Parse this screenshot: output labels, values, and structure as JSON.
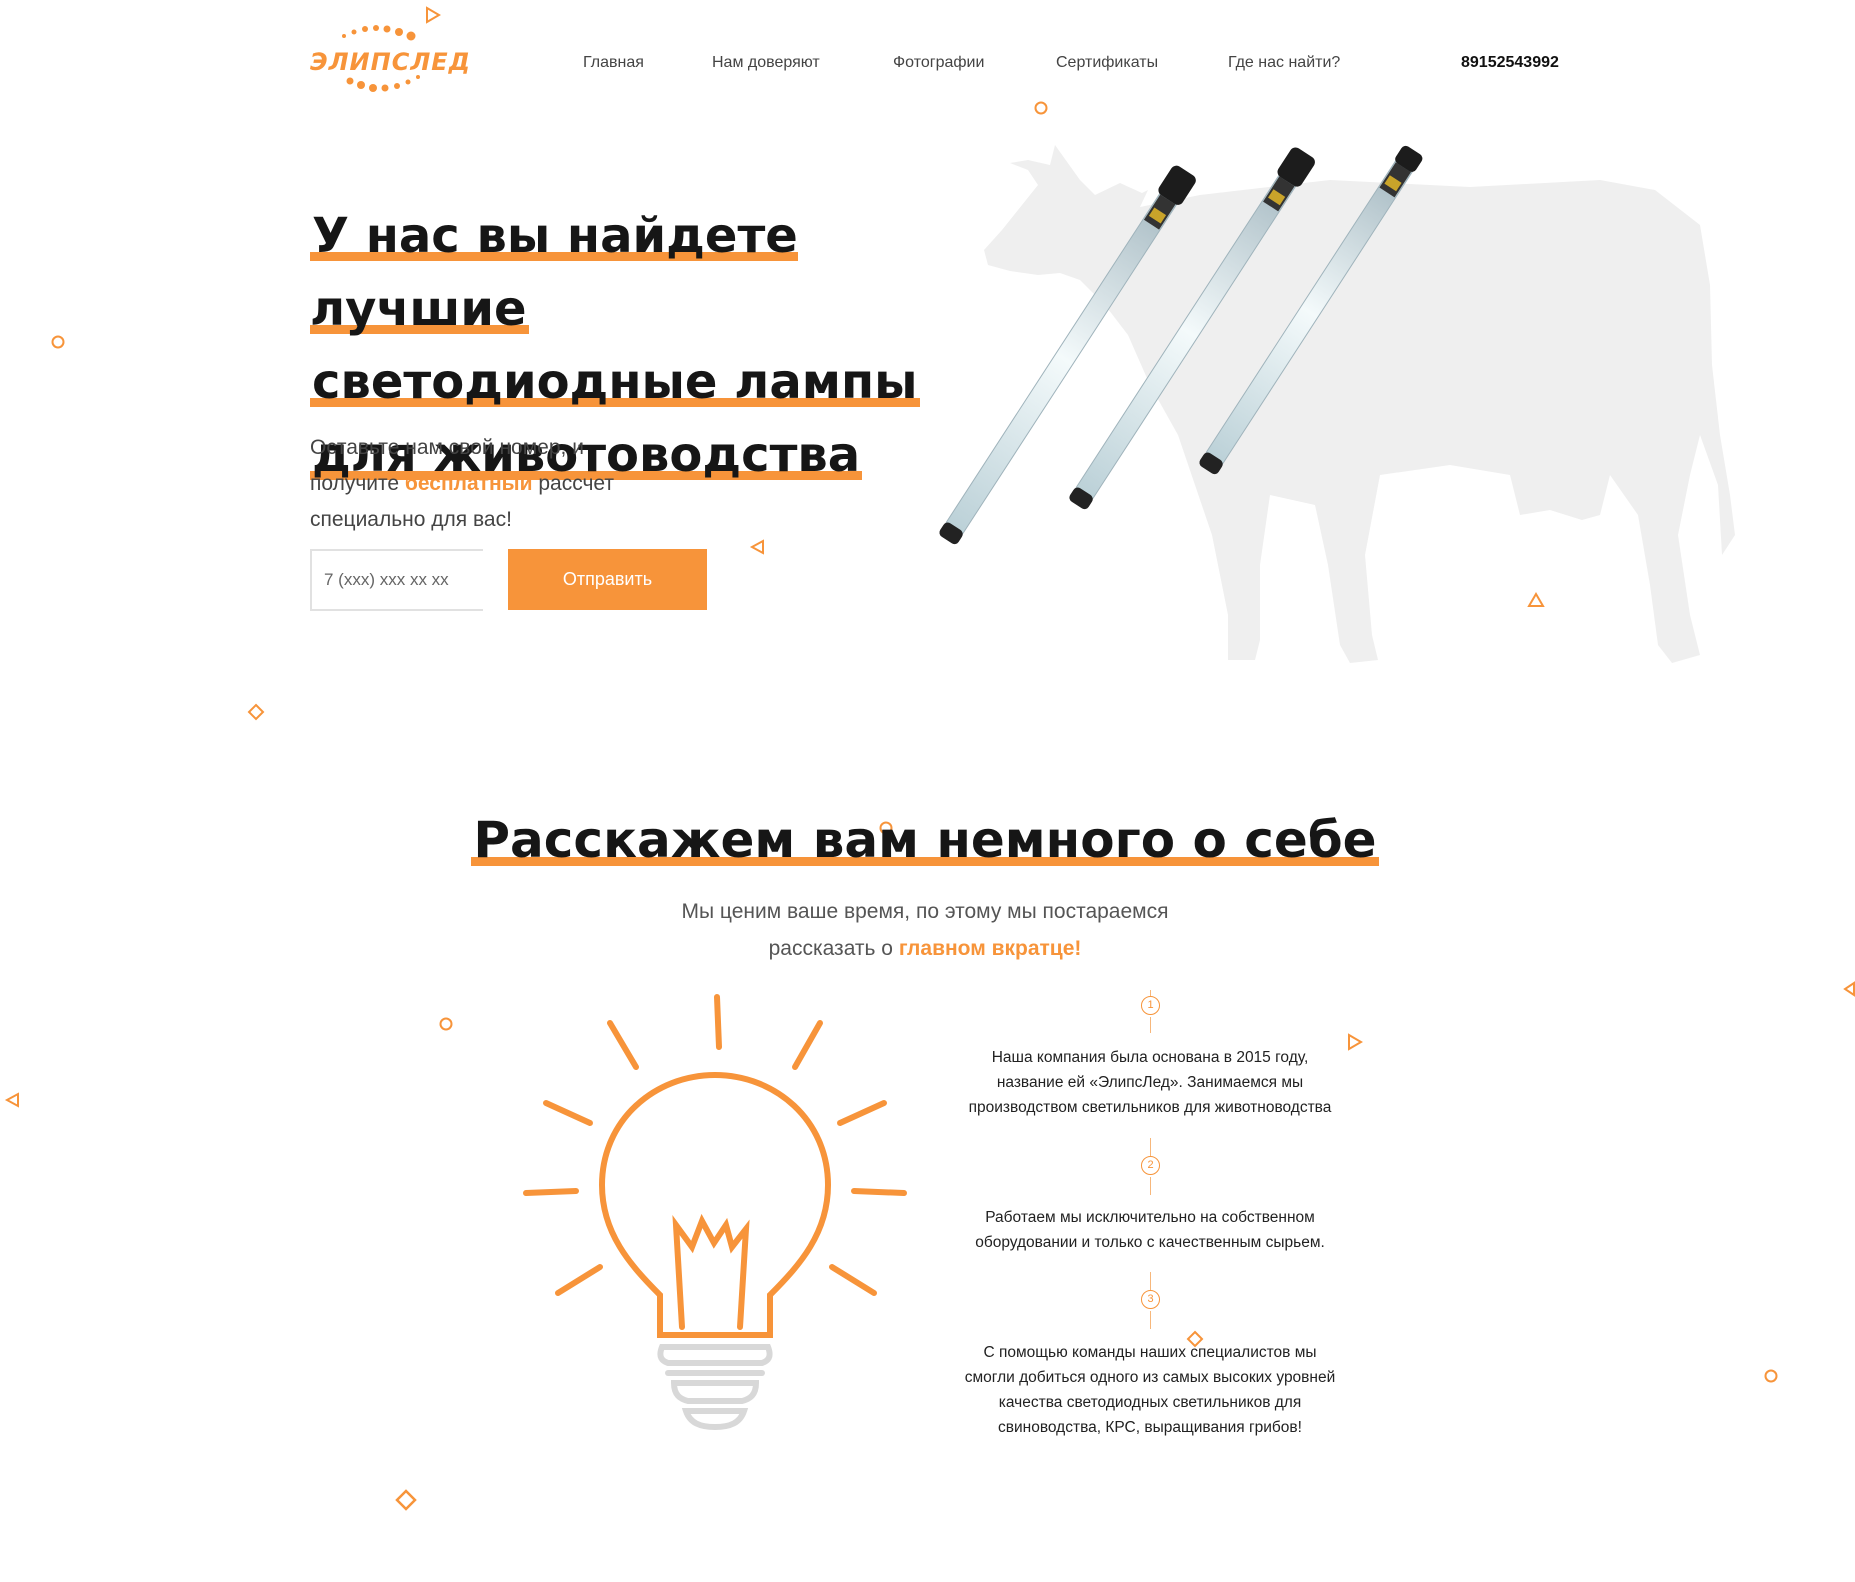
{
  "header": {
    "logo_text": "ЭЛИПСЛЕД",
    "nav": [
      "Главная",
      "Нам доверяют",
      "Фотографии",
      "Сертификаты",
      "Где нас найти?"
    ],
    "phone": "89152543992"
  },
  "hero": {
    "title_lines": [
      "У нас вы найдете лучшие",
      "светодиодные лампы",
      "для животоводства"
    ],
    "text_line1": "Оставьте нам свой номер, и",
    "text_line2_before": "получите ",
    "text_line2_accent": "бесплатный",
    "text_line2_after": " рассчет",
    "text_line3": "специально для вас!",
    "input_placeholder": "7 (xxx) xxx xx xx",
    "button_label": "Отправить"
  },
  "about": {
    "title": "Расскажем вам немного о себе",
    "subtitle_line1": "Мы ценим ваше время, по этому мы постараемся",
    "subtitle_line2_before": "рассказать о ",
    "subtitle_line2_accent": "главном вкратце!",
    "steps": [
      {
        "num": "1",
        "lines": [
          "Наша компания была основана в 2015 году,",
          "название ей «ЭлипсЛед». Занимаемся мы",
          "производством светильников для животноводства"
        ]
      },
      {
        "num": "2",
        "lines": [
          "Работаем мы исключительно на собственном",
          "оборудовании и только с качественным сырьем."
        ]
      },
      {
        "num": "3",
        "lines": [
          "С помощью команды наших специалистов мы",
          "смогли добиться одного из самых высоких уровней",
          "качества светодиодных светильников для",
          "свиноводства, КРС, выращивания грибов!"
        ]
      }
    ]
  },
  "colors": {
    "accent": "#f7943a",
    "text": "#222222",
    "cow": "#efefef"
  }
}
